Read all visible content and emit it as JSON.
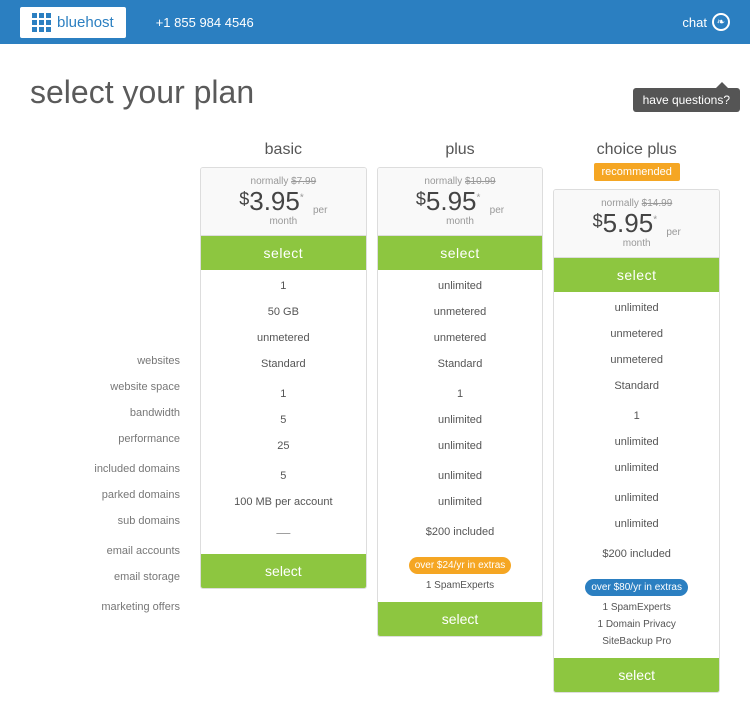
{
  "header": {
    "logo_text": "bluehost",
    "phone": "+1 855 984 4546",
    "chat_label": "chat",
    "questions_label": "have questions?"
  },
  "page": {
    "title": "select your plan"
  },
  "plans": [
    {
      "id": "basic",
      "name": "basic",
      "badge": null,
      "normally": "$7.99",
      "price": "$3.95",
      "asterisk": "*",
      "per": "per",
      "month": "month",
      "select_top": "select",
      "select_bottom": "select",
      "websites": "1",
      "website_space": "50 GB",
      "bandwidth": "unmetered",
      "performance": "Standard",
      "included_domains": "1",
      "parked_domains": "5",
      "sub_domains": "25",
      "email_accounts": "5",
      "email_storage": "100 MB per account",
      "marketing_offers": "—",
      "marketing_badge": null,
      "marketing_items": []
    },
    {
      "id": "plus",
      "name": "plus",
      "badge": null,
      "normally": "$10.99",
      "price": "$5.95",
      "asterisk": "*",
      "per": "per",
      "month": "month",
      "select_top": "select",
      "select_bottom": "select",
      "websites": "unlimited",
      "website_space": "unmetered",
      "bandwidth": "unmetered",
      "performance": "Standard",
      "included_domains": "1",
      "parked_domains": "unlimited",
      "sub_domains": "unlimited",
      "email_accounts": "unlimited",
      "email_storage": "unlimited",
      "marketing_offers": "$200 included",
      "marketing_badge": "over $24/yr in extras",
      "marketing_badge_color": "orange",
      "marketing_items": [
        "1 SpamExperts"
      ]
    },
    {
      "id": "choice-plus",
      "name": "choice plus",
      "badge": "recommended",
      "normally": "$14.99",
      "price": "$5.95",
      "asterisk": "*",
      "per": "per",
      "month": "month",
      "select_top": "select",
      "select_bottom": "select",
      "websites": "unlimited",
      "website_space": "unmetered",
      "bandwidth": "unmetered",
      "performance": "Standard",
      "included_domains": "1",
      "parked_domains": "unlimited",
      "sub_domains": "unlimited",
      "email_accounts": "unlimited",
      "email_storage": "unlimited",
      "marketing_offers": "$200 included",
      "marketing_badge": "over $80/yr in extras",
      "marketing_badge_color": "blue",
      "marketing_items": [
        "1 SpamExperts",
        "1 Domain Privacy",
        "SiteBackup Pro"
      ]
    }
  ],
  "row_labels": [
    {
      "id": "websites",
      "label": "websites"
    },
    {
      "id": "website_space",
      "label": "website space"
    },
    {
      "id": "bandwidth",
      "label": "bandwidth"
    },
    {
      "id": "performance",
      "label": "performance"
    },
    {
      "id": "included_domains",
      "label": "included domains"
    },
    {
      "id": "parked_domains",
      "label": "parked domains"
    },
    {
      "id": "sub_domains",
      "label": "sub domains"
    },
    {
      "id": "email_accounts",
      "label": "email accounts"
    },
    {
      "id": "email_storage",
      "label": "email storage"
    },
    {
      "id": "marketing_offers",
      "label": "marketing offers"
    }
  ]
}
